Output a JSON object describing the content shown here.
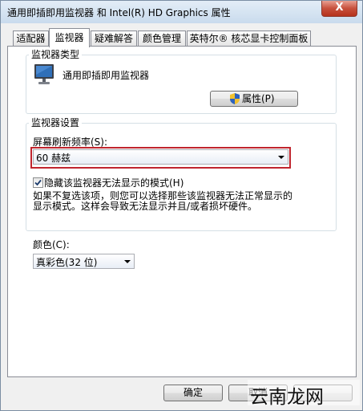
{
  "window": {
    "title": "通用即插即用监视器 和 Intel(R) HD Graphics 属性",
    "close_label": "X"
  },
  "tabs": [
    {
      "label": "适配器"
    },
    {
      "label": "监视器"
    },
    {
      "label": "疑难解答"
    },
    {
      "label": "颜色管理"
    },
    {
      "label": "英特尔® 核芯显卡控制面板"
    }
  ],
  "monitor_type": {
    "group_title": "监视器类型",
    "monitor_name": "通用即插即用监视器",
    "properties_button": "属性(P)"
  },
  "monitor_settings": {
    "group_title": "监视器设置",
    "refresh_label": "屏幕刷新频率(S):",
    "refresh_value": "60 赫兹",
    "hide_modes_label": "隐藏该监视器无法显示的模式(H)",
    "hide_modes_checked": true,
    "description_line1": "如果不复选该项，则您可以选择那些该监视器无法正常显示的",
    "description_line2": "显示模式。这样会导致无法显示并且/或者损坏硬件。"
  },
  "colors": {
    "label": "颜色(C):",
    "value": "真彩色(32 位)"
  },
  "footer": {
    "ok_button": "确定",
    "cancel_button": "取消"
  },
  "watermark": {
    "text": "云南龙网"
  },
  "accent": {
    "highlight_red": "#c0252e",
    "title_gradient_top": "#e3edf7",
    "close_red": "#c7503c"
  }
}
